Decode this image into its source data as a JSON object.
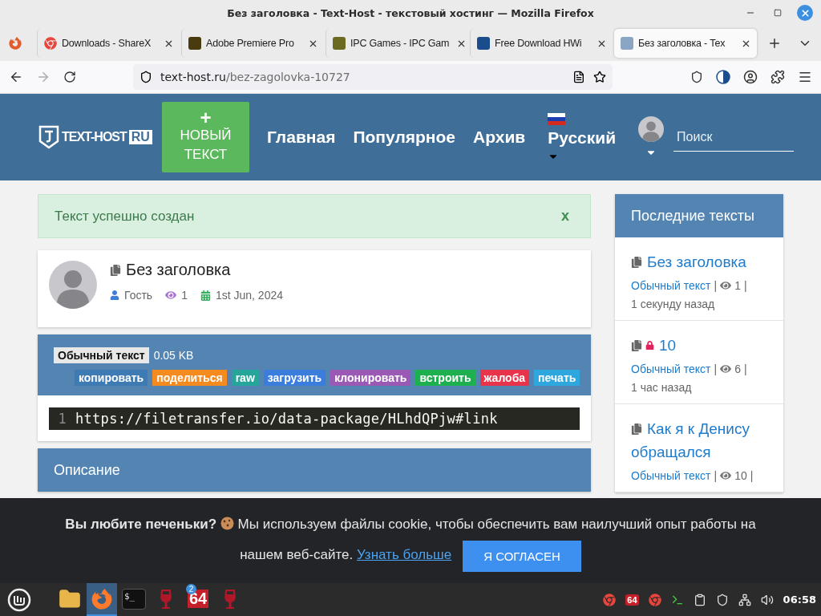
{
  "window": {
    "title": "Без заголовка - Text-Host - текстовый хостинг — Mozilla Firefox"
  },
  "tabs": [
    {
      "kind": "chrome",
      "label": "Downloads - ShareX",
      "selected": false
    },
    {
      "kind": "letter",
      "label": "Adobe Premiere Pro",
      "selected": false
    },
    {
      "kind": "ipc",
      "label": "IPC Games - IPC Gam",
      "selected": false
    },
    {
      "kind": "bars",
      "label": "Free Download HWi",
      "selected": false
    },
    {
      "kind": "site",
      "label": "Без заголовка - Tex",
      "selected": true
    }
  ],
  "address": {
    "host": "text-host.ru",
    "path": "/bez-zagolovka-10727"
  },
  "site": {
    "logo": "TEXT-HOST",
    "logo_badge": "RU",
    "new_button": {
      "plus": "+",
      "label": "НОВЫЙ ТЕКСТ"
    },
    "nav": [
      "Главная",
      "Популярное",
      "Архив"
    ],
    "language": "Русский",
    "search": {
      "placeholder": "Поиск"
    }
  },
  "alert": {
    "text": "Текст успешно создан",
    "close": "x"
  },
  "post": {
    "title": "Без заголовка",
    "author": "Гость",
    "views": "1",
    "date": "1st Jun, 2024"
  },
  "paste": {
    "syntax": "Обычный текст",
    "size": "0.05 KB",
    "actions": [
      {
        "label": "копировать",
        "color": "#3e7ab4"
      },
      {
        "label": "поделиться",
        "color": "#f58a1f"
      },
      {
        "label": "raw",
        "color": "#26a69a"
      },
      {
        "label": "загрузить",
        "color": "#3b7ddd"
      },
      {
        "label": "клонировать",
        "color": "#9b59b6"
      },
      {
        "label": "встроить",
        "color": "#1eb04f"
      },
      {
        "label": "жалоба",
        "color": "#e8344a"
      },
      {
        "label": "печать",
        "color": "#2ea7de"
      }
    ],
    "lines": [
      {
        "number": "1",
        "code": "https://filetransfer.io/data-package/HLhdQPjw#link"
      }
    ]
  },
  "description": {
    "title": "Описание"
  },
  "sidebar": {
    "title": "Последние тексты",
    "items": [
      {
        "title": "Без заголовка",
        "locked": false,
        "syntax": "Обычный текст",
        "separator_before": "|",
        "views": "1",
        "separator_after": "|",
        "time": "1 секунду назад"
      },
      {
        "title": "10",
        "locked": true,
        "syntax": "Обычный текст",
        "separator_before": "|",
        "views": "6",
        "separator_after": "|",
        "time": "1 час назад"
      },
      {
        "title": "Как я к Денису обращался",
        "locked": false,
        "syntax": "Обычный текст",
        "separator_before": "|",
        "views": "10",
        "separator_after": "|"
      }
    ]
  },
  "cookie": {
    "lead": "Вы любите печеньки?",
    "text": "Мы используем файлы cookie, чтобы обеспечить вам наилучший опыт работы на нашем веб-сайте.",
    "link": "Узнать больше",
    "button": "Я СОГЛАСЕН"
  },
  "taskbar": {
    "apps": [
      {
        "kind": "folder",
        "active": false
      },
      {
        "kind": "firefox",
        "active": true
      },
      {
        "kind": "terminal",
        "label": "$_",
        "active": false
      },
      {
        "kind": "wine",
        "active": false
      },
      {
        "kind": "counter",
        "label": "64",
        "badge": "2",
        "active": false
      },
      {
        "kind": "glass",
        "active": false
      }
    ],
    "tray_label": "64",
    "clock": "06:58"
  }
}
